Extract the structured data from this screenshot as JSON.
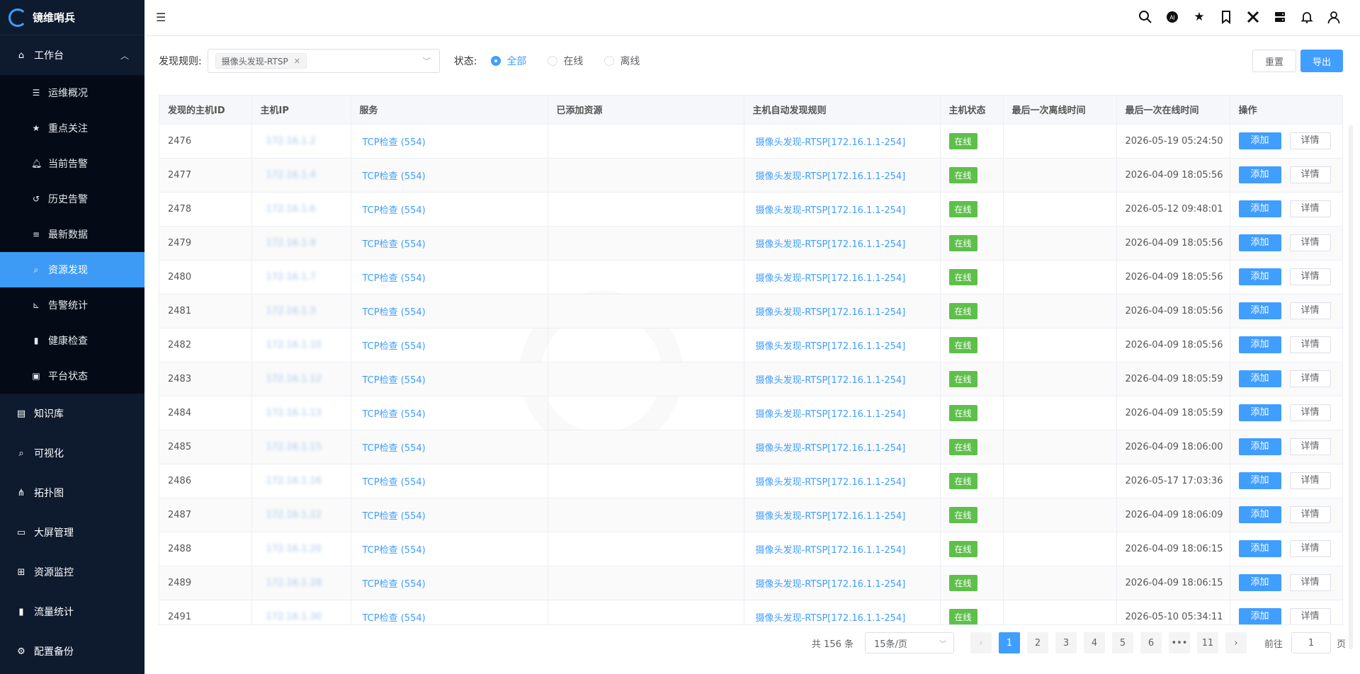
{
  "app": {
    "logo_text": "镜维哨兵"
  },
  "sidebar": {
    "workbench": "工作台",
    "sub_items": [
      {
        "label": "运维概况",
        "icon": "list-icon"
      },
      {
        "label": "重点关注",
        "icon": "star-icon"
      },
      {
        "label": "当前告警",
        "icon": "bell-icon"
      },
      {
        "label": "历史告警",
        "icon": "history-icon"
      },
      {
        "label": "最新数据",
        "icon": "database-icon"
      },
      {
        "label": "资源发现",
        "icon": "search-icon"
      },
      {
        "label": "告警统计",
        "icon": "chart-line-icon"
      },
      {
        "label": "健康检查",
        "icon": "bar-chart-icon"
      },
      {
        "label": "平台状态",
        "icon": "status-icon"
      }
    ],
    "items": [
      {
        "label": "知识库",
        "icon": "book-icon"
      },
      {
        "label": "可视化",
        "icon": "zoom-icon"
      },
      {
        "label": "拓扑图",
        "icon": "topology-icon"
      },
      {
        "label": "大屏管理",
        "icon": "monitor-icon"
      },
      {
        "label": "资源监控",
        "icon": "grid-icon"
      },
      {
        "label": "流量统计",
        "icon": "bar-icon"
      },
      {
        "label": "配置备份",
        "icon": "backup-icon"
      }
    ]
  },
  "filters": {
    "rule_label": "发现规则:",
    "rule_tag": "摄像头发现-RTSP",
    "status_label": "状态:",
    "status_options": [
      "全部",
      "在线",
      "离线"
    ],
    "reset": "重置",
    "export": "导出"
  },
  "table": {
    "columns": [
      "发现的主机ID",
      "主机IP",
      "服务",
      "已添加资源",
      "主机自动发现规则",
      "主机状态",
      "最后一次离线时间",
      "最后一次在线时间",
      "操作"
    ],
    "rows": [
      {
        "id": "2476",
        "ip": "172.16.1.2",
        "service": "TCP检查 (554)",
        "added": "",
        "rule": "摄像头发现-RTSP[172.16.1.1-254]",
        "status": "在线",
        "offline": "",
        "online": "2026-05-19 05:24:50"
      },
      {
        "id": "2477",
        "ip": "172.16.1.4",
        "service": "TCP检查 (554)",
        "added": "",
        "rule": "摄像头发现-RTSP[172.16.1.1-254]",
        "status": "在线",
        "offline": "",
        "online": "2026-04-09 18:05:56"
      },
      {
        "id": "2478",
        "ip": "172.16.1.6",
        "service": "TCP检查 (554)",
        "added": "",
        "rule": "摄像头发现-RTSP[172.16.1.1-254]",
        "status": "在线",
        "offline": "",
        "online": "2026-05-12 09:48:01"
      },
      {
        "id": "2479",
        "ip": "172.16.1.9",
        "service": "TCP检查 (554)",
        "added": "",
        "rule": "摄像头发现-RTSP[172.16.1.1-254]",
        "status": "在线",
        "offline": "",
        "online": "2026-04-09 18:05:56"
      },
      {
        "id": "2480",
        "ip": "172.16.1.7",
        "service": "TCP检查 (554)",
        "added": "",
        "rule": "摄像头发现-RTSP[172.16.1.1-254]",
        "status": "在线",
        "offline": "",
        "online": "2026-04-09 18:05:56"
      },
      {
        "id": "2481",
        "ip": "172.16.1.3",
        "service": "TCP检查 (554)",
        "added": "",
        "rule": "摄像头发现-RTSP[172.16.1.1-254]",
        "status": "在线",
        "offline": "",
        "online": "2026-04-09 18:05:56"
      },
      {
        "id": "2482",
        "ip": "172.16.1.10",
        "service": "TCP检查 (554)",
        "added": "",
        "rule": "摄像头发现-RTSP[172.16.1.1-254]",
        "status": "在线",
        "offline": "",
        "online": "2026-04-09 18:05:56"
      },
      {
        "id": "2483",
        "ip": "172.16.1.12",
        "service": "TCP检查 (554)",
        "added": "",
        "rule": "摄像头发现-RTSP[172.16.1.1-254]",
        "status": "在线",
        "offline": "",
        "online": "2026-04-09 18:05:59"
      },
      {
        "id": "2484",
        "ip": "172.16.1.13",
        "service": "TCP检查 (554)",
        "added": "",
        "rule": "摄像头发现-RTSP[172.16.1.1-254]",
        "status": "在线",
        "offline": "",
        "online": "2026-04-09 18:05:59"
      },
      {
        "id": "2485",
        "ip": "172.16.1.15",
        "service": "TCP检查 (554)",
        "added": "",
        "rule": "摄像头发现-RTSP[172.16.1.1-254]",
        "status": "在线",
        "offline": "",
        "online": "2026-04-09 18:06:00"
      },
      {
        "id": "2486",
        "ip": "172.16.1.16",
        "service": "TCP检查 (554)",
        "added": "",
        "rule": "摄像头发现-RTSP[172.16.1.1-254]",
        "status": "在线",
        "offline": "",
        "online": "2026-05-17 17:03:36"
      },
      {
        "id": "2487",
        "ip": "172.16.1.22",
        "service": "TCP检查 (554)",
        "added": "",
        "rule": "摄像头发现-RTSP[172.16.1.1-254]",
        "status": "在线",
        "offline": "",
        "online": "2026-04-09 18:06:09"
      },
      {
        "id": "2488",
        "ip": "172.16.1.20",
        "service": "TCP检查 (554)",
        "added": "",
        "rule": "摄像头发现-RTSP[172.16.1.1-254]",
        "status": "在线",
        "offline": "",
        "online": "2026-04-09 18:06:15"
      },
      {
        "id": "2489",
        "ip": "172.16.1.28",
        "service": "TCP检查 (554)",
        "added": "",
        "rule": "摄像头发现-RTSP[172.16.1.1-254]",
        "status": "在线",
        "offline": "",
        "online": "2026-04-09 18:06:15"
      },
      {
        "id": "2491",
        "ip": "172.16.1.30",
        "service": "TCP检查 (554)",
        "added": "",
        "rule": "摄像头发现-RTSP[172.16.1.1-254]",
        "status": "在线",
        "offline": "",
        "online": "2026-05-10 05:34:11"
      }
    ],
    "action_add": "添加",
    "action_detail": "详情"
  },
  "pager": {
    "total": "共 156 条",
    "size": "15条/页",
    "pages": [
      "1",
      "2",
      "3",
      "4",
      "5",
      "6",
      "•••",
      "11"
    ],
    "goto_label": "前往",
    "goto_value": "1",
    "goto_suffix": "页"
  },
  "colors": {
    "accent": "#409eff",
    "sidebar_bg": "#0e1a2e",
    "active": "#3d9bf5",
    "online": "#5ec04a"
  }
}
